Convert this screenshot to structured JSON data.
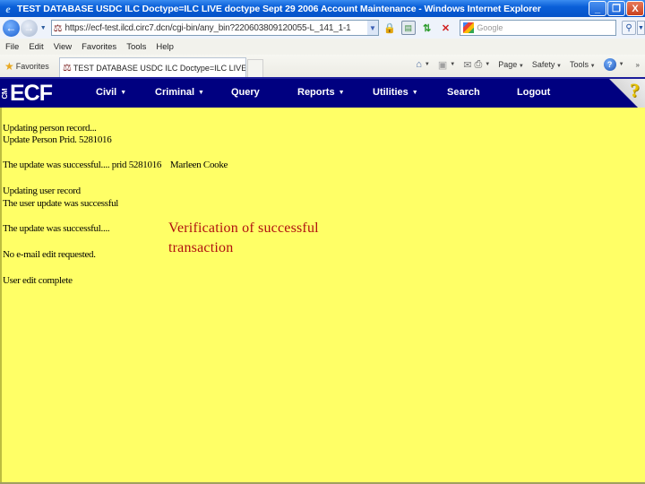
{
  "window": {
    "title": "TEST DATABASE USDC ILC Doctype=ILC LIVE doctype Sept 29 2006 Account Maintenance - Windows Internet Explorer",
    "buttons": {
      "minimize": "_",
      "restore": "❐",
      "close": "X"
    }
  },
  "address_bar": {
    "url": "https://ecf-test.ilcd.circ7.dcn/cgi-bin/any_bin?220603809120055-L_141_1-1",
    "search_placeholder": "Google"
  },
  "menu": [
    "File",
    "Edit",
    "View",
    "Favorites",
    "Tools",
    "Help"
  ],
  "favorites_bar": {
    "favorites_label": "Favorites",
    "tab_title": "TEST DATABASE USDC ILC Doctype=ILC LIVE doctyp ...",
    "commands": {
      "page": "Page",
      "safety": "Safety",
      "tools": "Tools"
    }
  },
  "ecf_nav": {
    "logo_small": "CM",
    "logo_main": "ECF",
    "items": [
      {
        "label": "Civil",
        "has_dropdown": true
      },
      {
        "label": "Criminal",
        "has_dropdown": true
      },
      {
        "label": "Query",
        "has_dropdown": false
      },
      {
        "label": "Reports",
        "has_dropdown": true
      },
      {
        "label": "Utilities",
        "has_dropdown": true
      },
      {
        "label": "Search",
        "has_dropdown": false
      },
      {
        "label": "Logout",
        "has_dropdown": false
      }
    ],
    "help_symbol": "?"
  },
  "content": {
    "lines": [
      "Updating person record...",
      "Update Person Prid. 5281016",
      "The update was successful.... prid 5281016    Marleen Cooke",
      "Updating user record",
      "The user update was successful",
      "The update was successful....",
      "No e-mail edit requested.",
      "User edit complete"
    ],
    "callout": [
      "Verification of successful",
      "transaction"
    ]
  },
  "colors": {
    "nav_bg": "#000080",
    "content_bg": "#ffff66",
    "callout": "#b01010"
  }
}
